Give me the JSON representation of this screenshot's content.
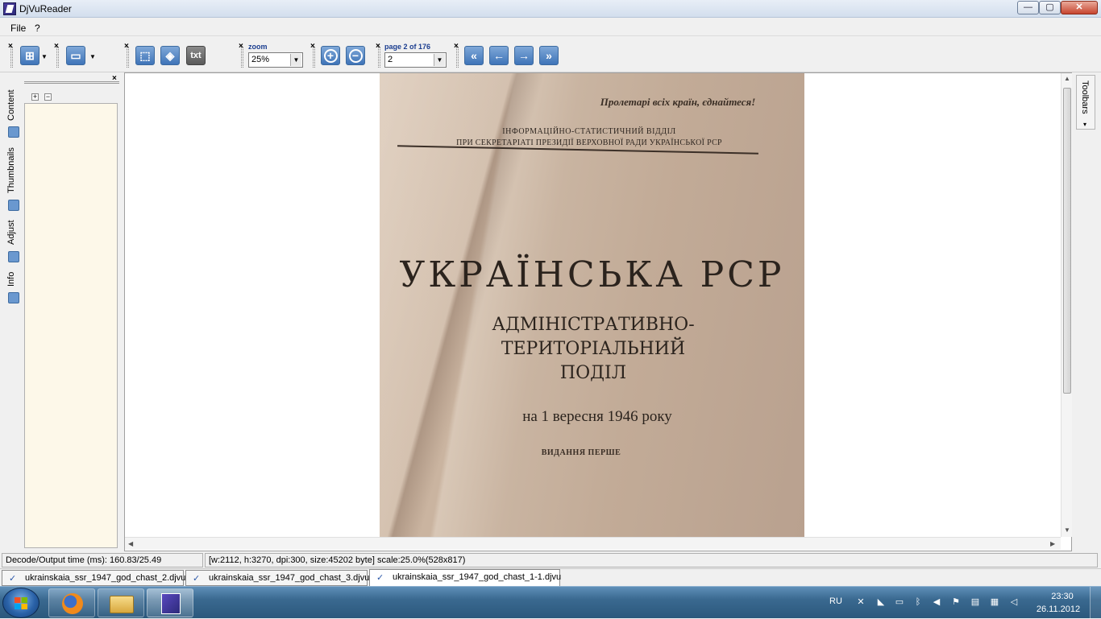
{
  "window": {
    "title": "DjVuReader",
    "controls": {
      "minimize": "—",
      "maximize": "▢",
      "close": "✕"
    }
  },
  "menu": {
    "items": [
      "File",
      "?"
    ]
  },
  "toolbar": {
    "zoom": {
      "label": "zoom",
      "value": "25%"
    },
    "page": {
      "label": "page 2 of 176",
      "value": "2"
    },
    "text_button": "txt",
    "close_glyph": "×"
  },
  "left_panel": {
    "tabs": [
      "Content",
      "Thumbnails",
      "Adjust",
      "Info"
    ],
    "expand_all": "+",
    "collapse_all": "−"
  },
  "right_panel": {
    "tab_label": "Toolbars"
  },
  "document_page": {
    "slogan": "Пролетарі всіх країн, єднайтеся!",
    "department_line1": "ІНФОРМАЦІЙНО-СТАТИСТИЧНИЙ ВІДДІЛ",
    "department_line2": "ПРИ СЕКРЕТАРІАТІ ПРЕЗИДІЇ ВЕРХОВНОЇ РАДИ УКРАЇНСЬКОЇ РСР",
    "title": "УКРАЇНСЬКА РСР",
    "subtitle_line1": "АДМІНІСТРАТИВНО-",
    "subtitle_line2": "ТЕРИТОРІАЛЬНИЙ",
    "subtitle_line3": "ПОДІЛ",
    "date": "на 1 вересня 1946 року",
    "edition": "ВИДАННЯ ПЕРШЕ"
  },
  "status": {
    "decode_time": "Decode/Output time (ms): 160.83/25.49",
    "page_info": "[w:2112, h:3270, dpi:300, size:45202 byte] scale:25.0%(528x817)"
  },
  "doc_tabs": [
    {
      "label": "ukrainskaia_ssr_1947_god_chast_2.djvu",
      "active": false
    },
    {
      "label": "ukrainskaia_ssr_1947_god_chast_3.djvu",
      "active": false
    },
    {
      "label": "ukrainskaia_ssr_1947_god_chast_1-1.djvu",
      "active": true
    }
  ],
  "taskbar": {
    "apps": [
      "firefox-icon",
      "explorer-folder-icon",
      "djvureader-icon"
    ],
    "language": "RU",
    "clock_time": "23:30",
    "clock_date": "26.11.2012"
  },
  "colors": {
    "panel_bg": "#fdf8e9",
    "toolbar_button": "#3f74b8",
    "taskbar": "#2b587c"
  }
}
